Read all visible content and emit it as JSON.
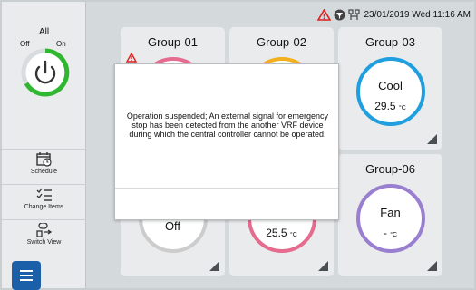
{
  "status_bar": {
    "datetime": "23/01/2019 Wed 11:16 AM",
    "icons": [
      "warning-triangle-icon",
      "filter-icon",
      "vrf-link-icon"
    ],
    "warning_color": "#e02020"
  },
  "sidebar": {
    "all_label": "All",
    "off_label": "Off",
    "on_label": "On",
    "power_state": "on",
    "on_color": "#2fb82f",
    "buttons": [
      {
        "label": "Schedule",
        "icon": "calendar-clock-icon"
      },
      {
        "label": "Change Items",
        "icon": "checklist-icon"
      },
      {
        "label": "Switch View",
        "icon": "switch-view-icon"
      }
    ],
    "menu_icon": "hamburger-menu-icon",
    "menu_color": "#1a5fa8"
  },
  "groups": [
    {
      "name": "Group-01",
      "ring_color": "#e56b8f",
      "warning": true
    },
    {
      "name": "Group-02",
      "ring_color": "#f2b01e"
    },
    {
      "name": "Group-03",
      "mode": "Cool",
      "temp": "29.5",
      "unit": "°C",
      "ring_color": "#1f9ee0"
    },
    {
      "name": "",
      "mode": "Off",
      "ring_color": "#cccccc"
    },
    {
      "name": "",
      "temp": "25.5",
      "unit": "°C",
      "ring_color": "#e56b8f"
    },
    {
      "name": "Group-06",
      "mode": "Fan",
      "temp": "-",
      "unit": "°C",
      "ring_color": "#9a7fd1"
    }
  ],
  "dialog": {
    "message": "Operation suspended; An external signal for emergency stop has been detected from the another VRF device during which the central controller cannot be operated."
  }
}
